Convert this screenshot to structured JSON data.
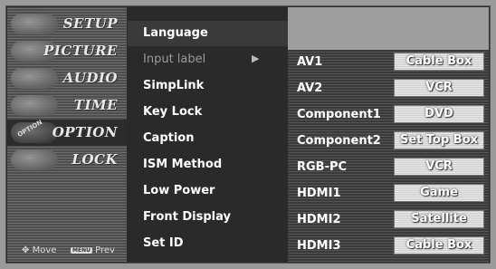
{
  "nav": {
    "items": [
      {
        "label": "SETUP"
      },
      {
        "label": "PICTURE"
      },
      {
        "label": "AUDIO"
      },
      {
        "label": "TIME"
      },
      {
        "label": "OPTION",
        "icon_text": "OPTION"
      },
      {
        "label": "LOCK"
      }
    ],
    "footer": {
      "move": "Move",
      "menu_key": "MENU",
      "prev": "Prev"
    }
  },
  "menu": {
    "items": [
      {
        "label": "Language"
      },
      {
        "label": "Input label",
        "arrow": "▶"
      },
      {
        "label": "SimpLink"
      },
      {
        "label": "Key Lock"
      },
      {
        "label": "Caption"
      },
      {
        "label": "ISM Method"
      },
      {
        "label": "Low Power"
      },
      {
        "label": "Front Display"
      },
      {
        "label": "Set ID"
      }
    ]
  },
  "input_labels": [
    {
      "input": "AV1",
      "value": "Cable Box"
    },
    {
      "input": "AV2",
      "value": "VCR"
    },
    {
      "input": "Component1",
      "value": "DVD"
    },
    {
      "input": "Component2",
      "value": "Set Top Box"
    },
    {
      "input": "RGB-PC",
      "value": "VCR"
    },
    {
      "input": "HDMI1",
      "value": "Game"
    },
    {
      "input": "HDMI2",
      "value": "Satellite"
    },
    {
      "input": "HDMI3",
      "value": "Cable Box"
    }
  ],
  "icons": {
    "move": "dpad-icon",
    "arrow": "right-arrow-icon"
  }
}
